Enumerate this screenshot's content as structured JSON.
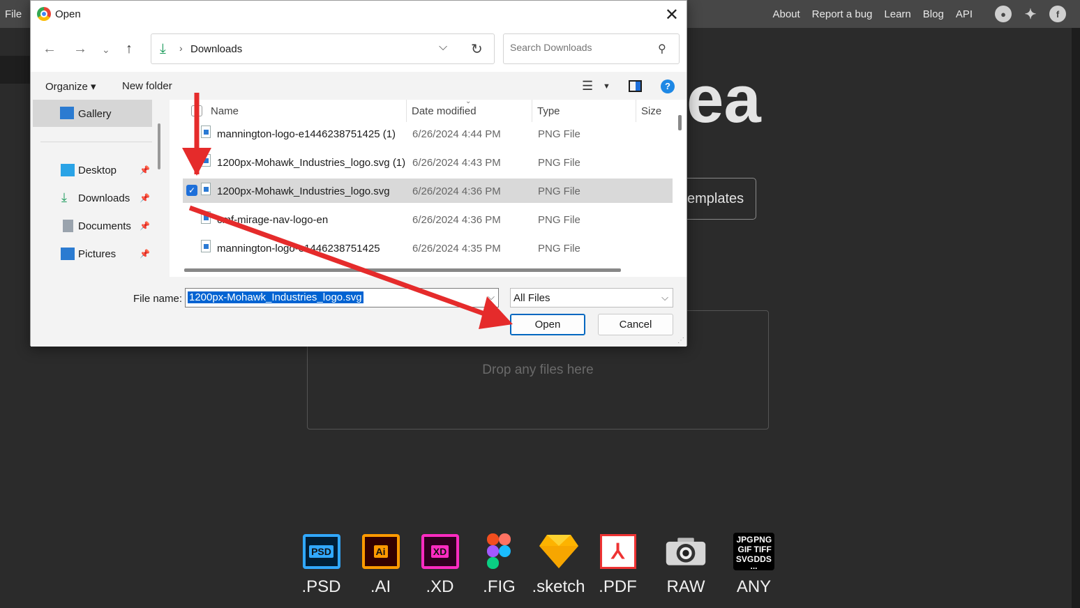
{
  "app": {
    "menu_file": "File",
    "nav": [
      "About",
      "Report a bug",
      "Learn",
      "Blog",
      "API"
    ],
    "social_icons": [
      "reddit-icon",
      "twitter-icon",
      "facebook-icon"
    ],
    "hero_partial": "ea",
    "templates_partial": "emplates",
    "dropzone_text": "Drop any files here",
    "formats": [
      {
        "label": ".PSD",
        "icon": "PSD",
        "color": "#31a8ff"
      },
      {
        "label": ".AI",
        "icon": "Ai",
        "color": "#ff9a00"
      },
      {
        "label": ".XD",
        "icon": "XD",
        "color": "#ff2bc2"
      },
      {
        "label": ".FIG",
        "icon": "figma-icon"
      },
      {
        "label": ".sketch",
        "icon": "sketch-icon",
        "color": "#fdb300"
      },
      {
        "label": ".PDF",
        "icon": "pdf-icon",
        "color": "#e33333"
      },
      {
        "label": "RAW",
        "icon": "camera-icon"
      },
      {
        "label": "ANY",
        "icon_text": [
          "JPG",
          "PNG",
          "GIF",
          "TIFF",
          "SVG",
          "DDS",
          "..."
        ]
      }
    ]
  },
  "dialog": {
    "title": "Open",
    "address": {
      "folder": "Downloads"
    },
    "search_placeholder": "Search Downloads",
    "toolbar": {
      "organize": "Organize",
      "new_folder": "New folder"
    },
    "nav_pane": {
      "gallery": "Gallery",
      "items": [
        "Desktop",
        "Downloads",
        "Documents",
        "Pictures"
      ]
    },
    "columns": {
      "name": "Name",
      "date": "Date modified",
      "type": "Type",
      "size": "Size"
    },
    "files": [
      {
        "name": "mannington-logo-e1446238751425 (1)",
        "date": "6/26/2024 4:44 PM",
        "type": "PNG File"
      },
      {
        "name": "1200px-Mohawk_Industries_logo.svg (1)",
        "date": "6/26/2024 4:43 PM",
        "type": "PNG File"
      },
      {
        "name": "1200px-Mohawk_Industries_logo.svg",
        "date": "6/26/2024 4:36 PM",
        "type": "PNG File"
      },
      {
        "name": "cmf-mirage-nav-logo-en",
        "date": "6/26/2024 4:36 PM",
        "type": "PNG File"
      },
      {
        "name": "mannington-logo-e1446238751425",
        "date": "6/26/2024 4:35 PM",
        "type": "PNG File"
      }
    ],
    "file_name_label": "File name:",
    "file_name_value": "1200px-Mohawk_Industries_logo.svg",
    "filter_value": "All Files",
    "open_button": "Open",
    "cancel_button": "Cancel"
  },
  "annotation_color": "#e52b2b"
}
